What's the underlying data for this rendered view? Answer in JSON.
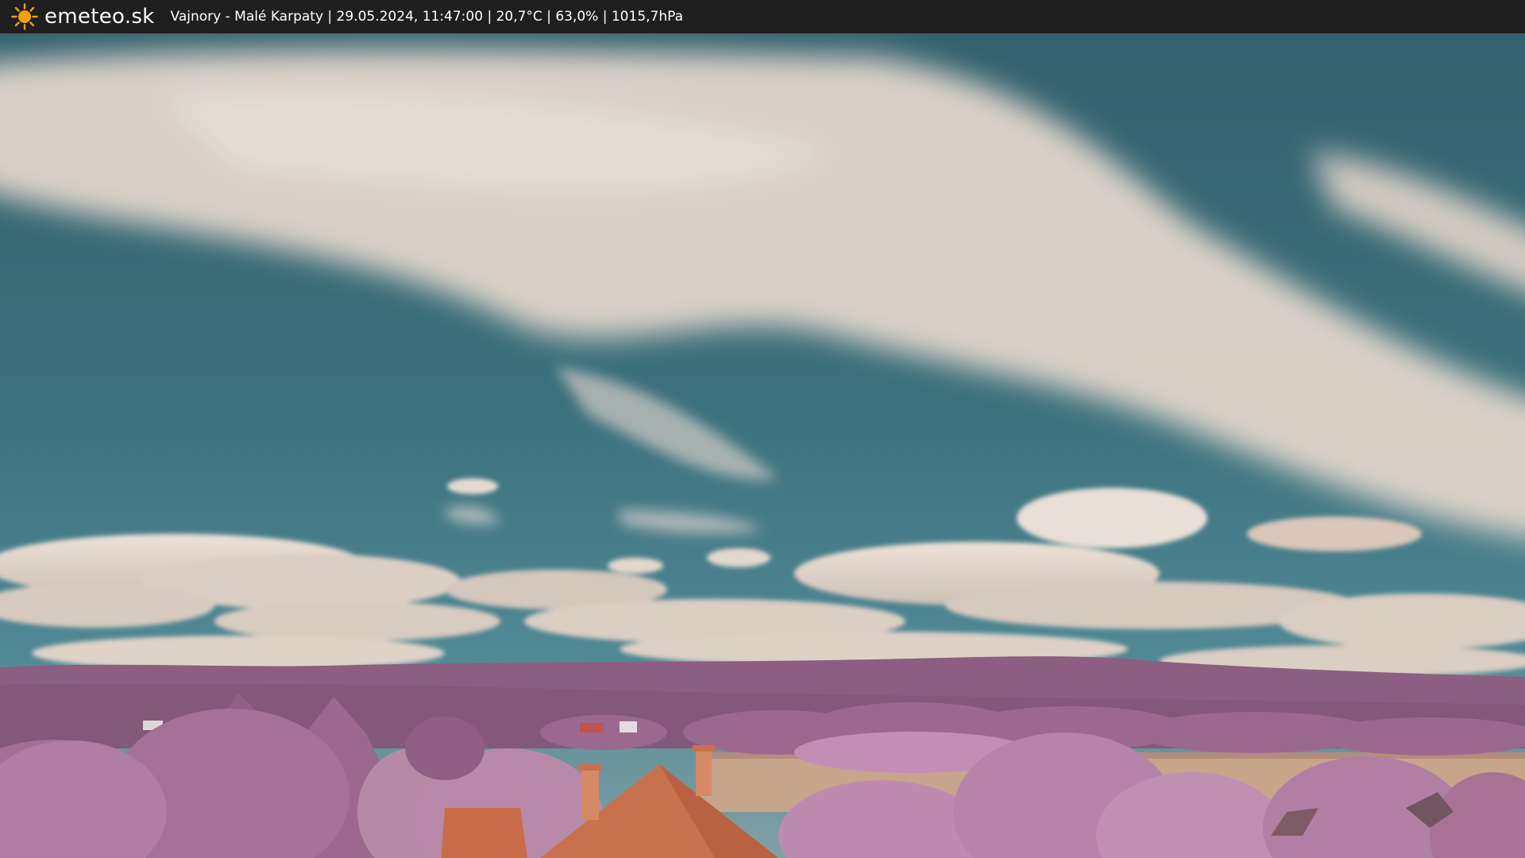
{
  "header": {
    "logo_icon": "sun-icon",
    "brand": "emeteo.sk",
    "info": "Vajnory - Malé Karpaty | 29.05.2024, 11:47:00 | 20,7°C | 63,0% | 1015,7hPa"
  },
  "colors": {
    "header_bg": "#1f1f1f",
    "sun": "#f2a20c",
    "sky_top": "#2f6777",
    "sky_horizon": "#4e8d9c",
    "cloud": "#e6ddd4",
    "hills": "#8a5c83",
    "foliage": "#b681ab",
    "roof": "#c66a48",
    "field": "#c9a98f"
  }
}
